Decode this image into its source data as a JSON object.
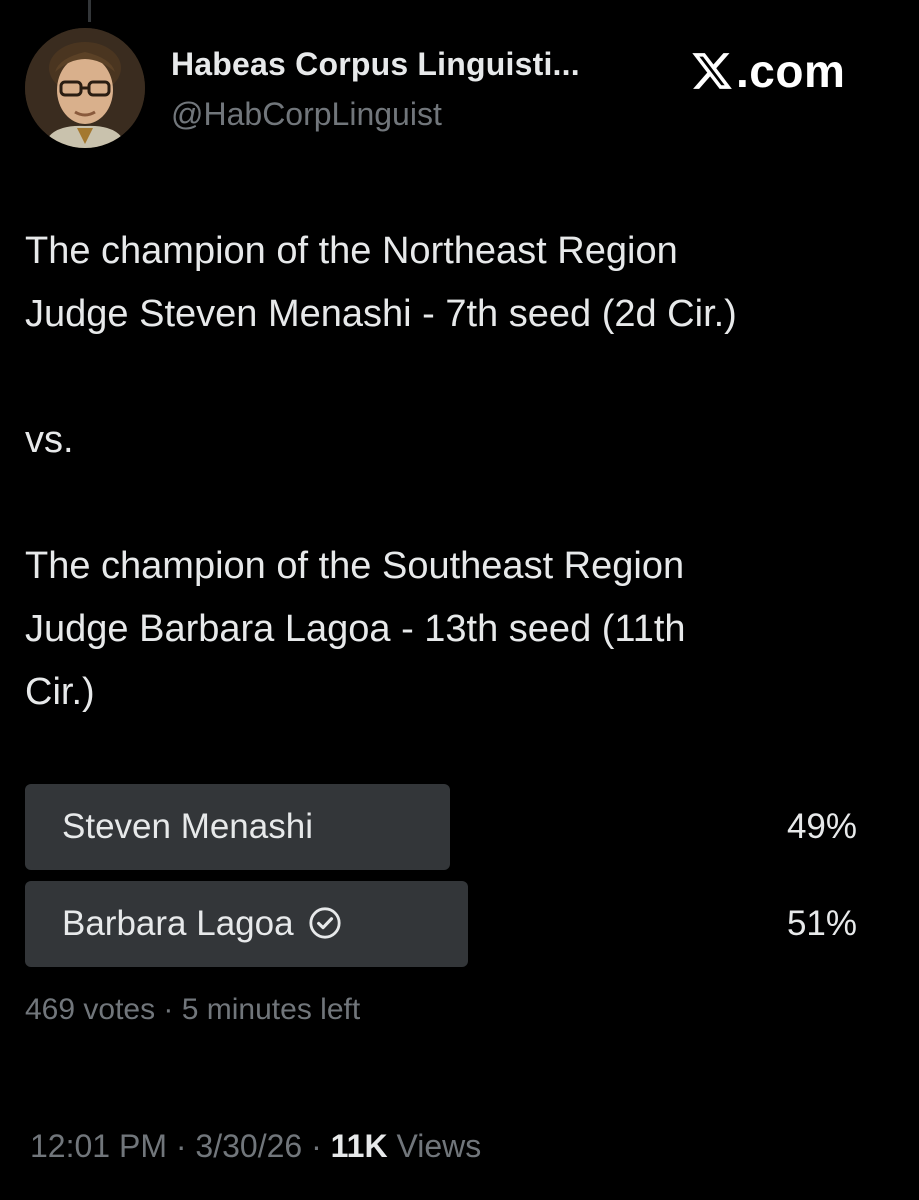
{
  "author": {
    "display_name": "Habeas Corpus Linguisti...",
    "handle": "@HabCorpLinguist",
    "avatar_icon": "profile-photo"
  },
  "brand": {
    "text": ".com",
    "icon": "x-logo-icon"
  },
  "tweet": {
    "text": "The champion of the Northeast Region\nJudge Steven Menashi - 7th seed (2d Cir.)\n\nvs.\n\nThe champion of the Southeast Region\nJudge Barbara Lagoa - 13th seed (11th\nCir.)"
  },
  "poll": {
    "options": [
      {
        "label": "Steven Menashi",
        "percent_text": "49%",
        "percent": 49,
        "selected": false
      },
      {
        "label": "Barbara Lagoa",
        "percent_text": "51%",
        "percent": 51,
        "selected": true
      }
    ],
    "meta": "469 votes · 5 minutes left"
  },
  "footer": {
    "time_date": "12:01 PM · 3/30/26 · ",
    "views_count": "11K",
    "views_label": " Views"
  },
  "colors": {
    "background": "#000000",
    "primary_text": "#e7e9ea",
    "secondary_text": "#71767b",
    "poll_bar": "#333639"
  }
}
